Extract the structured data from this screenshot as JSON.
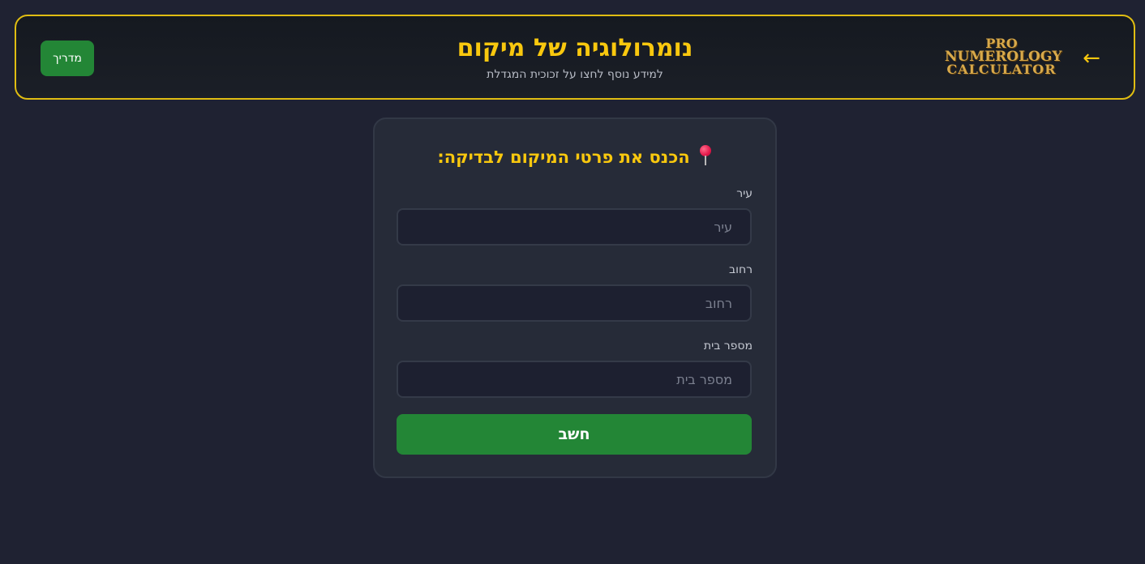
{
  "header": {
    "guide_label": "מדריך",
    "title": "נומרולוגיה של מיקום",
    "subtitle": "למידע נוסף לחצו על זכוכית המגדלת",
    "logo": {
      "line1": "PRO",
      "line2": "NUMEROLOGY",
      "line3": "CALCULATOR"
    },
    "back_arrow": "←",
    "border_color": "#e0bd12"
  },
  "form": {
    "title": "הכנס את פרטי המיקום לבדיקה:",
    "title_icon": "pin-icon",
    "fields": [
      {
        "label": "עיר",
        "placeholder": "עיר",
        "value": ""
      },
      {
        "label": "רחוב",
        "placeholder": "רחוב",
        "value": ""
      },
      {
        "label": "מספר בית",
        "placeholder": "מספר בית",
        "value": ""
      }
    ],
    "submit_label": "חשב"
  },
  "colors": {
    "accent": "#f9c80e",
    "button": "#238636",
    "background": "#1f2232"
  }
}
